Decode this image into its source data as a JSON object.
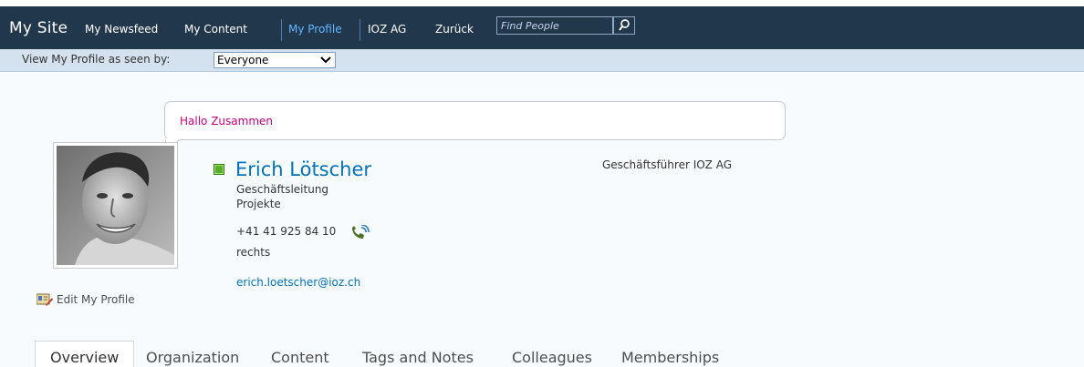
{
  "topbar": {
    "site_title": "My Site",
    "nav": [
      {
        "label": "My Newsfeed"
      },
      {
        "label": "My Content"
      },
      {
        "label": "My Profile"
      },
      {
        "label": "IOZ AG"
      },
      {
        "label": "Zurück"
      }
    ],
    "search_placeholder": "Find People",
    "active_color": "#62b6ff",
    "bar_color": "#21374c"
  },
  "view_bar": {
    "label": "View My Profile as seen by:",
    "selected": "Everyone"
  },
  "status_message": "Hallo Zusammen",
  "profile": {
    "name": "Erich Lötscher",
    "department": "Geschäftsleitung",
    "office": "Projekte",
    "phone": "+41 41 925 84 10",
    "location": "rechts",
    "email": "erich.loetscher@ioz.ch",
    "job_title": "Geschäftsführer IOZ AG",
    "presence_status": "online",
    "edit_link": "Edit My Profile"
  },
  "tabs": [
    {
      "label": "Overview",
      "active": true
    },
    {
      "label": "Organization"
    },
    {
      "label": "Content"
    },
    {
      "label": "Tags and Notes"
    },
    {
      "label": "Colleagues"
    },
    {
      "label": "Memberships"
    }
  ],
  "colors": {
    "name": "#0072bc",
    "status_message": "#c8007a",
    "presence": "#5aad2b"
  }
}
